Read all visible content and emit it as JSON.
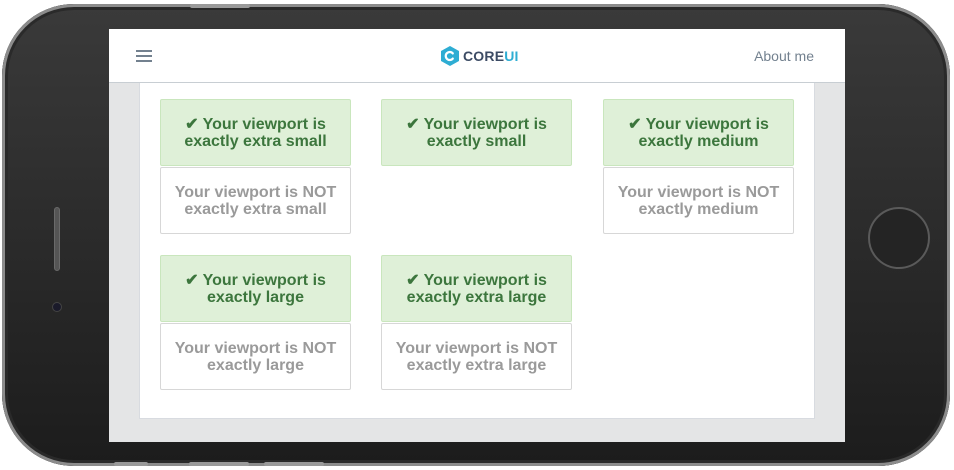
{
  "header": {
    "menu_icon": "hamburger-icon",
    "brand_core": "CORE",
    "brand_ui": "UI",
    "about_label": "About me"
  },
  "colors": {
    "success_bg": "#dff0d8",
    "success_text": "#3c763d",
    "brand_accent": "#2eadd3"
  },
  "viewport_tests": {
    "xs_yes": "✔ Your viewport is exactly extra small",
    "xs_no": "Your viewport is NOT exactly extra small",
    "sm_yes": "✔ Your viewport is exactly small",
    "md_yes": "✔ Your viewport is exactly medium",
    "md_no": "Your viewport is NOT exactly medium",
    "lg_yes": "✔ Your viewport is exactly large",
    "lg_no": "Your viewport is NOT exactly large",
    "xl_yes": "✔ Your viewport is exactly extra large",
    "xl_no": "Your viewport is NOT exactly extra large"
  }
}
